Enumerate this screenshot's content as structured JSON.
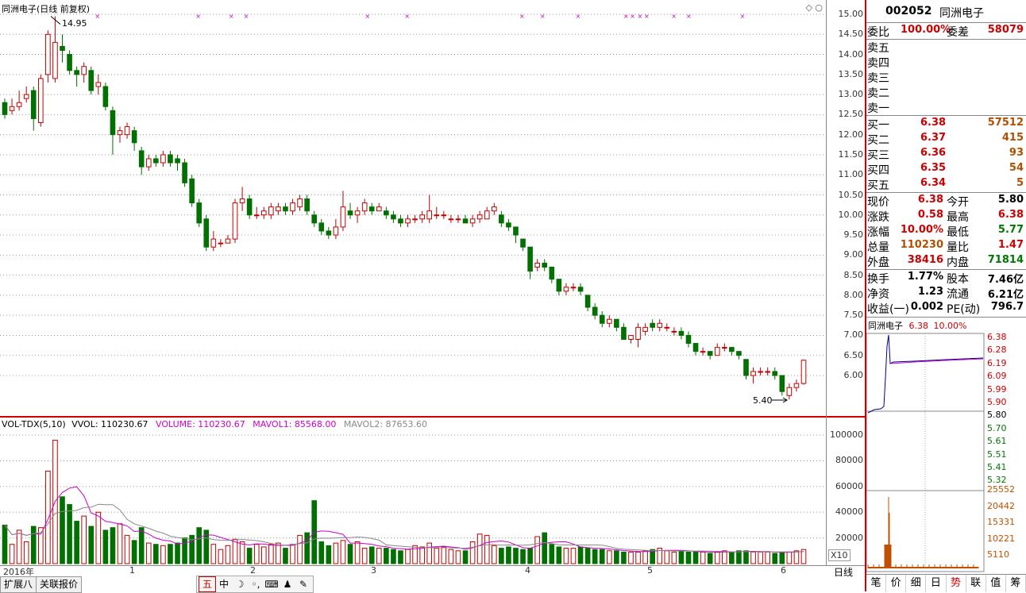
{
  "chart_title": "同洲电子(日线 前复权)",
  "price_high_label": "14.95",
  "price_low_label": "5.40",
  "price_axis": [
    "15.00",
    "14.50",
    "14.00",
    "13.50",
    "13.00",
    "12.50",
    "12.00",
    "11.50",
    "11.00",
    "10.50",
    "10.00",
    "9.50",
    "9.00",
    "8.50",
    "8.00",
    "7.50",
    "7.00",
    "6.50",
    "6.00"
  ],
  "vol_indicator": {
    "name": "VOL-TDX(5,10)",
    "vvol": "VVOL: 110230.67",
    "volume": "VOLUME: 110230.67",
    "mavol1": "MAVOL1: 85568.00",
    "mavol2": "MAVOL2: 87653.60"
  },
  "vol_axis": [
    "100000",
    "80000",
    "60000",
    "40000",
    "20000"
  ],
  "vol_unit": "X10",
  "date_labels": [
    "2016年",
    "1",
    "2",
    "3",
    "4",
    "5",
    "6"
  ],
  "period_label": "日线",
  "bottom_tabs": [
    "扩展八",
    "关联报价"
  ],
  "tools": [
    "五",
    "中",
    "☽",
    "◦,",
    "⌨",
    "♟",
    "✎"
  ],
  "colors": {
    "up": "#c00000",
    "down": "#007000",
    "ma1": "#cc00cc",
    "ma2": "#888888",
    "marker": "#cc00cc"
  },
  "chart_data": {
    "type": "candlestick",
    "ylim": [
      5.2,
      15.1
    ],
    "candles": [
      [
        12.8,
        12.5,
        12.9,
        12.4
      ],
      [
        12.6,
        12.7,
        12.9,
        12.5
      ],
      [
        12.7,
        12.8,
        13.1,
        12.6
      ],
      [
        12.9,
        13.0,
        13.2,
        12.8
      ],
      [
        13.1,
        12.4,
        13.2,
        12.1
      ],
      [
        12.3,
        13.4,
        13.5,
        12.2
      ],
      [
        13.5,
        14.5,
        14.6,
        13.3
      ],
      [
        13.4,
        14.3,
        14.95,
        13.3
      ],
      [
        14.2,
        14.1,
        14.5,
        13.8
      ],
      [
        14.0,
        13.6,
        14.1,
        13.5
      ],
      [
        13.6,
        13.5,
        13.7,
        13.2
      ],
      [
        13.5,
        13.7,
        13.8,
        13.3
      ],
      [
        13.6,
        13.1,
        13.7,
        13.0
      ],
      [
        13.2,
        13.3,
        13.5,
        13.0
      ],
      [
        13.2,
        12.7,
        13.3,
        12.6
      ],
      [
        12.6,
        12.0,
        12.7,
        11.5
      ],
      [
        12.0,
        12.1,
        12.2,
        11.8
      ],
      [
        12.0,
        12.2,
        12.3,
        11.9
      ],
      [
        12.1,
        11.8,
        12.2,
        11.6
      ],
      [
        11.6,
        11.2,
        11.7,
        11.0
      ],
      [
        11.2,
        11.4,
        11.5,
        11.1
      ],
      [
        11.4,
        11.3,
        11.5,
        11.2
      ],
      [
        11.3,
        11.5,
        11.6,
        11.2
      ],
      [
        11.5,
        11.3,
        11.6,
        11.2
      ],
      [
        11.4,
        11.3,
        11.5,
        11.1
      ],
      [
        11.3,
        10.8,
        11.4,
        10.7
      ],
      [
        10.9,
        10.3,
        11.0,
        10.2
      ],
      [
        10.3,
        9.8,
        10.4,
        9.7
      ],
      [
        9.9,
        9.2,
        10.0,
        9.1
      ],
      [
        9.2,
        9.4,
        9.6,
        9.1
      ],
      [
        9.3,
        9.3,
        9.4,
        9.2
      ],
      [
        9.3,
        9.4,
        9.5,
        9.3
      ],
      [
        9.4,
        10.3,
        10.4,
        9.3
      ],
      [
        10.3,
        10.4,
        10.7,
        10.1
      ],
      [
        10.4,
        10.0,
        10.5,
        9.9
      ],
      [
        10.0,
        10.0,
        10.2,
        9.9
      ],
      [
        10.0,
        10.1,
        10.2,
        9.9
      ],
      [
        10.0,
        10.2,
        10.3,
        9.9
      ],
      [
        10.1,
        10.2,
        10.3,
        10.0
      ],
      [
        10.2,
        10.1,
        10.3,
        10.0
      ],
      [
        10.1,
        10.3,
        10.4,
        10.0
      ],
      [
        10.2,
        10.4,
        10.5,
        10.1
      ],
      [
        10.4,
        10.1,
        10.5,
        10.0
      ],
      [
        10.0,
        9.8,
        10.1,
        9.7
      ],
      [
        9.8,
        9.6,
        9.9,
        9.5
      ],
      [
        9.6,
        9.5,
        9.7,
        9.4
      ],
      [
        9.5,
        9.7,
        9.9,
        9.4
      ],
      [
        9.7,
        10.2,
        10.6,
        9.6
      ],
      [
        10.1,
        10.0,
        10.3,
        9.9
      ],
      [
        10.0,
        10.1,
        10.2,
        9.8
      ],
      [
        10.1,
        10.3,
        10.4,
        10.0
      ],
      [
        10.2,
        10.1,
        10.3,
        10.0
      ],
      [
        10.1,
        10.2,
        10.3,
        10.1
      ],
      [
        10.1,
        10.0,
        10.2,
        9.9
      ],
      [
        10.0,
        9.9,
        10.1,
        9.8
      ],
      [
        9.9,
        9.8,
        10.0,
        9.7
      ],
      [
        9.8,
        9.9,
        10.0,
        9.7
      ],
      [
        9.9,
        9.9,
        10.0,
        9.8
      ],
      [
        9.9,
        10.0,
        10.1,
        9.8
      ],
      [
        9.9,
        10.1,
        10.5,
        9.8
      ],
      [
        10.0,
        10.0,
        10.2,
        9.9
      ],
      [
        10.0,
        10.0,
        10.1,
        9.9
      ],
      [
        9.9,
        9.9,
        10.0,
        9.8
      ],
      [
        9.9,
        9.9,
        10.0,
        9.8
      ],
      [
        9.9,
        9.8,
        10.0,
        9.8
      ],
      [
        9.8,
        9.9,
        10.0,
        9.7
      ],
      [
        9.9,
        10.0,
        10.1,
        9.8
      ],
      [
        9.9,
        10.1,
        10.2,
        9.9
      ],
      [
        10.1,
        10.2,
        10.3,
        10.0
      ],
      [
        10.0,
        9.8,
        10.1,
        9.7
      ],
      [
        9.8,
        9.7,
        9.9,
        9.6
      ],
      [
        9.7,
        9.5,
        9.7,
        9.3
      ],
      [
        9.4,
        9.2,
        9.4,
        9.1
      ],
      [
        9.2,
        8.6,
        9.2,
        8.4
      ],
      [
        8.7,
        8.8,
        8.9,
        8.6
      ],
      [
        8.8,
        8.7,
        8.9,
        8.6
      ],
      [
        8.7,
        8.4,
        8.7,
        8.3
      ],
      [
        8.4,
        8.1,
        8.4,
        8.0
      ],
      [
        8.1,
        8.2,
        8.3,
        8.0
      ],
      [
        8.2,
        8.2,
        8.3,
        8.1
      ],
      [
        8.2,
        8.1,
        8.3,
        8.0
      ],
      [
        8.0,
        7.7,
        8.0,
        7.6
      ],
      [
        7.7,
        7.5,
        7.8,
        7.4
      ],
      [
        7.5,
        7.3,
        7.6,
        7.2
      ],
      [
        7.3,
        7.4,
        7.5,
        7.2
      ],
      [
        7.4,
        7.2,
        7.4,
        7.1
      ],
      [
        7.2,
        6.9,
        7.3,
        6.9
      ],
      [
        6.9,
        7.0,
        7.0,
        6.8
      ],
      [
        6.9,
        7.2,
        7.3,
        6.7
      ],
      [
        7.1,
        7.2,
        7.3,
        7.0
      ],
      [
        7.3,
        7.2,
        7.4,
        7.1
      ],
      [
        7.2,
        7.3,
        7.4,
        7.1
      ],
      [
        7.2,
        7.2,
        7.3,
        7.1
      ],
      [
        7.1,
        7.1,
        7.2,
        7.0
      ],
      [
        7.1,
        7.0,
        7.2,
        6.9
      ],
      [
        7.0,
        6.8,
        7.1,
        6.7
      ],
      [
        6.8,
        6.6,
        6.8,
        6.5
      ],
      [
        6.6,
        6.6,
        6.7,
        6.5
      ],
      [
        6.6,
        6.5,
        6.6,
        6.4
      ],
      [
        6.5,
        6.7,
        6.8,
        6.5
      ],
      [
        6.7,
        6.7,
        6.8,
        6.6
      ],
      [
        6.7,
        6.6,
        6.7,
        6.5
      ],
      [
        6.6,
        6.5,
        6.6,
        6.4
      ],
      [
        6.4,
        6.0,
        6.4,
        5.9
      ],
      [
        6.0,
        6.1,
        6.2,
        5.8
      ],
      [
        6.1,
        6.1,
        6.2,
        6.0
      ],
      [
        6.1,
        6.1,
        6.2,
        6.0
      ],
      [
        6.1,
        6.0,
        6.2,
        5.9
      ],
      [
        6.0,
        5.6,
        6.0,
        5.5
      ],
      [
        5.5,
        5.7,
        5.8,
        5.4
      ],
      [
        5.7,
        5.8,
        5.9,
        5.6
      ],
      [
        5.8,
        6.38,
        6.4,
        5.77
      ]
    ],
    "volumes": [
      30000,
      15000,
      26000,
      17000,
      29000,
      28000,
      72000,
      96000,
      52000,
      46000,
      33000,
      37000,
      29000,
      40000,
      26000,
      28000,
      31000,
      22000,
      18000,
      28000,
      16000,
      15000,
      14000,
      15000,
      16000,
      20000,
      22000,
      28000,
      26000,
      15000,
      11000,
      14000,
      19000,
      17000,
      12000,
      15000,
      13000,
      15000,
      16000,
      12000,
      15000,
      22000,
      24000,
      49000,
      17000,
      14000,
      16000,
      18000,
      15000,
      17000,
      12000,
      13000,
      12000,
      12000,
      11000,
      10000,
      11000,
      14000,
      13000,
      16000,
      12000,
      13000,
      11000,
      10000,
      10000,
      17000,
      23000,
      22000,
      14000,
      12000,
      13000,
      12000,
      11000,
      12000,
      21000,
      24000,
      15000,
      13000,
      12000,
      12000,
      13000,
      12000,
      11000,
      11000,
      10000,
      10000,
      9000,
      9000,
      9000,
      10000,
      11000,
      12000,
      10000,
      9000,
      10000,
      9000,
      9000,
      9000,
      8000,
      9000,
      10000,
      9000,
      10000,
      10000,
      9000,
      9000,
      9000,
      8000,
      9000,
      9000,
      10000,
      11000
    ],
    "ylabel": "",
    "vol_ylim": [
      0,
      105000
    ]
  },
  "markers_x": [
    0.118,
    0.24,
    0.28,
    0.298,
    0.445,
    0.493,
    0.632,
    0.657,
    0.7,
    0.758,
    0.766,
    0.775,
    0.783,
    0.816,
    0.834,
    0.899
  ],
  "panel": {
    "code": "002052",
    "name": "同洲电子",
    "weibi_label": "委比",
    "weibi": "100.00%",
    "weicha_label": "委差",
    "weicha": "58079",
    "sell": [
      {
        "label": "卖五",
        "price": "",
        "vol": ""
      },
      {
        "label": "卖四",
        "price": "",
        "vol": ""
      },
      {
        "label": "卖三",
        "price": "",
        "vol": ""
      },
      {
        "label": "卖二",
        "price": "",
        "vol": ""
      },
      {
        "label": "卖一",
        "price": "",
        "vol": ""
      }
    ],
    "buy": [
      {
        "label": "买一",
        "price": "6.38",
        "vol": "57512"
      },
      {
        "label": "买二",
        "price": "6.37",
        "vol": "415"
      },
      {
        "label": "买三",
        "price": "6.36",
        "vol": "93"
      },
      {
        "label": "买四",
        "price": "6.35",
        "vol": "54"
      },
      {
        "label": "买五",
        "price": "6.34",
        "vol": "5"
      }
    ],
    "quote": [
      {
        "l1": "现价",
        "v1": "6.38",
        "c1": "red",
        "l2": "今开",
        "v2": "5.80",
        "c2": "black"
      },
      {
        "l1": "涨跌",
        "v1": "0.58",
        "c1": "red",
        "l2": "最高",
        "v2": "6.38",
        "c2": "red"
      },
      {
        "l1": "涨幅",
        "v1": "10.00%",
        "c1": "red",
        "l2": "最低",
        "v2": "5.77",
        "c2": "green"
      },
      {
        "l1": "总量",
        "v1": "110230",
        "c1": "brown",
        "l2": "量比",
        "v2": "1.47",
        "c2": "red"
      },
      {
        "l1": "外盘",
        "v1": "38416",
        "c1": "red",
        "l2": "内盘",
        "v2": "71814",
        "c2": "green"
      }
    ],
    "fund": [
      {
        "l1": "换手",
        "v1": "1.77%",
        "l2": "股本",
        "v2": "7.46亿"
      },
      {
        "l1": "净资",
        "v1": "1.23",
        "l2": "流通",
        "v2": "6.21亿"
      },
      {
        "l1": "收益(一)",
        "v1": "0.002",
        "l2": "PE(动)",
        "v2": "796.7"
      }
    ],
    "mini_title": "同洲电子",
    "mini_price": "6.38",
    "mini_pct": "10.00%",
    "mini_price_axis": [
      "6.38",
      "6.28",
      "6.19",
      "6.09",
      "5.99",
      "5.90",
      "5.80",
      "5.70",
      "5.61",
      "5.51",
      "5.41",
      "5.32"
    ],
    "mini_vol_axis": [
      "25552",
      "20442",
      "15331",
      "10221",
      "5110"
    ],
    "tabs": [
      "笔",
      "价",
      "细",
      "日",
      "势",
      "联",
      "值",
      "筹"
    ],
    "active_tab": "势"
  }
}
